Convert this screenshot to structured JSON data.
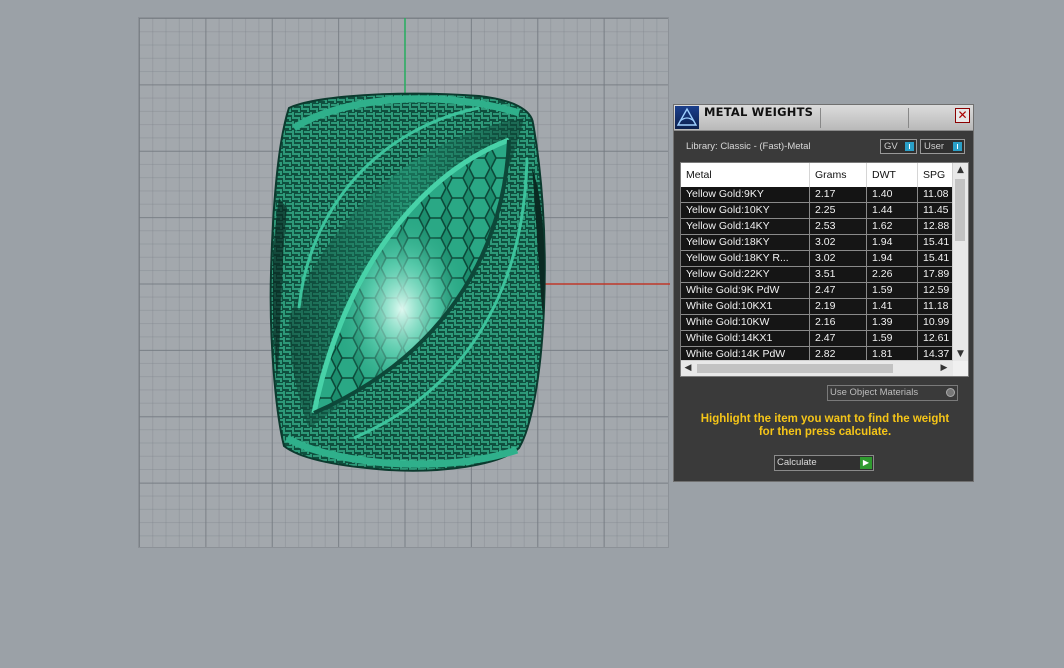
{
  "panel": {
    "title": "METAL WEIGHTS",
    "close_glyph": "✕",
    "library_label": "Library: Classic - (Fast)-Metal",
    "toggles": {
      "gv": "GV",
      "user": "User"
    },
    "columns": [
      "Metal",
      "Grams",
      "DWT",
      "SPG"
    ],
    "rows": [
      [
        "Yellow Gold:9KY",
        "2.17",
        "1.40",
        "11.08"
      ],
      [
        "Yellow Gold:10KY",
        "2.25",
        "1.44",
        "11.45"
      ],
      [
        "Yellow Gold:14KY",
        "2.53",
        "1.62",
        "12.88"
      ],
      [
        "Yellow Gold:18KY",
        "3.02",
        "1.94",
        "15.41"
      ],
      [
        "Yellow Gold:18KY R...",
        "3.02",
        "1.94",
        "15.41"
      ],
      [
        "Yellow Gold:22KY",
        "3.51",
        "2.26",
        "17.89"
      ],
      [
        "White Gold:9K PdW",
        "2.47",
        "1.59",
        "12.59"
      ],
      [
        "White Gold:10KX1",
        "2.19",
        "1.41",
        "11.18"
      ],
      [
        "White Gold:10KW",
        "2.16",
        "1.39",
        "10.99"
      ],
      [
        "White Gold:14KX1",
        "2.47",
        "1.59",
        "12.61"
      ],
      [
        "White Gold:14K PdW",
        "2.82",
        "1.81",
        "14.37"
      ]
    ],
    "use_object_materials": "Use Object Materials",
    "hint_line1": "Highlight the item you want to find the weight",
    "hint_line2": "for then press calculate.",
    "calculate_label": "Calculate",
    "icons": {
      "logo": "rhino-logo-icon",
      "close": "close-icon",
      "scroll_up": "chevron-up-icon",
      "scroll_down": "chevron-down-icon",
      "scroll_left": "chevron-left-icon",
      "scroll_right": "chevron-right-icon",
      "calculate": "play-arrow-icon"
    }
  },
  "colors": {
    "model": "#1e8a6c",
    "hint_text": "#f5c518",
    "panel_bg": "#3a3a3a",
    "x_axis": "#c0392b",
    "y_axis": "#27ae60"
  }
}
